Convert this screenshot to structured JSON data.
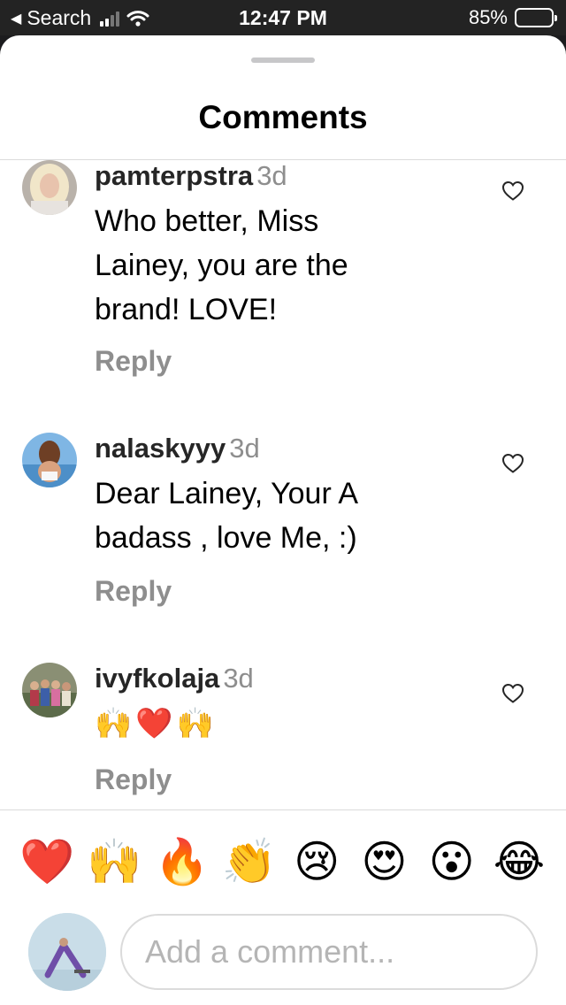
{
  "status_bar": {
    "back_label": "Search",
    "time": "12:47 PM",
    "battery_text": "85%",
    "battery_level": 0.85
  },
  "sheet": {
    "title": "Comments"
  },
  "comments": [
    {
      "username": "pamterpstra",
      "time": "3d",
      "text": "Who better, Miss\nLainey, you are the\nbrand!  LOVE!",
      "reply_label": "Reply",
      "liked": false
    },
    {
      "username": "nalaskyyy",
      "time": "3d",
      "text": "Dear Lainey, Your A\nbadass , love Me, :)",
      "reply_label": "Reply",
      "liked": false
    },
    {
      "username": "ivyfkolaja",
      "time": "3d",
      "text": "🙌❤️🙌",
      "reply_label": "Reply",
      "liked": false
    }
  ],
  "quick_emojis": [
    "❤️",
    "🙌",
    "🔥",
    "👏",
    "😢",
    "😍",
    "😮",
    "😂"
  ],
  "composer": {
    "placeholder": "Add a comment..."
  },
  "colors": {
    "heart_outline": "#262626",
    "muted_text": "#8e8e8e",
    "divider": "#dbdbdb"
  }
}
